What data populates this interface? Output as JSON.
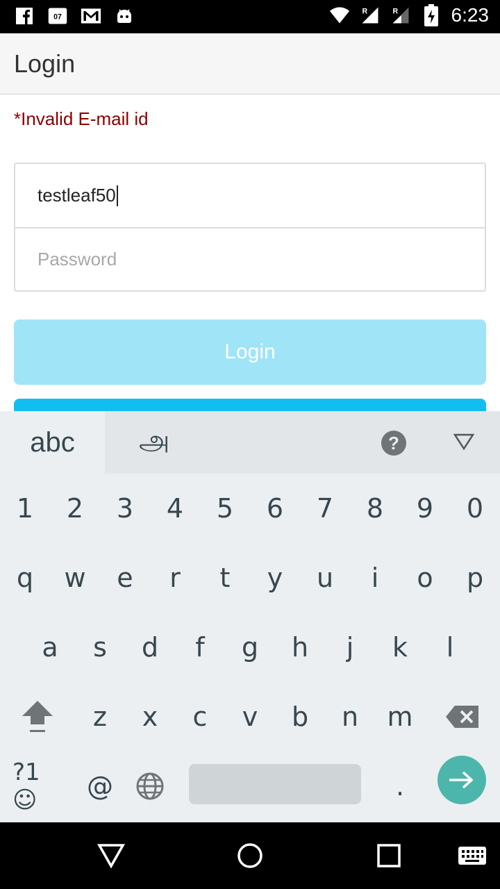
{
  "status_bar": {
    "time": "6:23",
    "left_icons": [
      "facebook-icon",
      "calendar-app-icon",
      "gmail-icon",
      "android-icon"
    ],
    "right_icons": [
      "wifi-icon",
      "signal-roaming-icon",
      "signal-roaming-icon",
      "battery-charging-icon"
    ],
    "roaming_label": "R",
    "calendar_text": "07"
  },
  "header": {
    "title": "Login"
  },
  "form": {
    "error_message": "*Invalid E-mail id",
    "email_value": "testleaf50",
    "password_placeholder": "Password",
    "login_button_label": "Login"
  },
  "keyboard": {
    "tab_abc": "abc",
    "tab_tamil": "அ",
    "help_label": "?",
    "number_row": [
      "1",
      "2",
      "3",
      "4",
      "5",
      "6",
      "7",
      "8",
      "9",
      "0"
    ],
    "row_q": [
      "q",
      "w",
      "e",
      "r",
      "t",
      "y",
      "u",
      "i",
      "o",
      "p"
    ],
    "row_a": [
      "a",
      "s",
      "d",
      "f",
      "g",
      "h",
      "j",
      "k",
      "l"
    ],
    "row_z": [
      "z",
      "x",
      "c",
      "v",
      "b",
      "n",
      "m"
    ],
    "symbols_label": "?1☺",
    "at_label": "@",
    "period_label": ".",
    "accent_color": "#4db6ac"
  },
  "nav_bar": {
    "buttons": [
      "back-icon",
      "home-icon",
      "recents-icon",
      "keyboard-switch-icon"
    ]
  }
}
